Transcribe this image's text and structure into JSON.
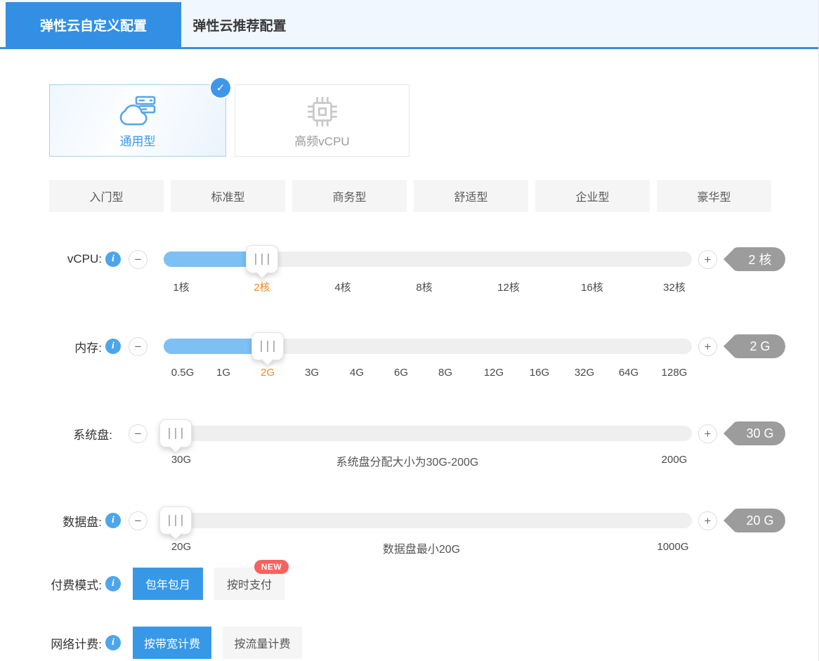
{
  "colors": {
    "accent": "#338FE3",
    "slider_fill": "#7EC0F3",
    "badge_bg": "#9C9C9C",
    "active_tick": "#F5861F",
    "new_badge_bg": "#F8625E"
  },
  "glyphs": {
    "minus": "−",
    "plus": "+",
    "info": "i",
    "check": "✓"
  },
  "tabs": [
    {
      "label": "弹性云自定义配置",
      "active": true
    },
    {
      "label": "弹性云推荐配置",
      "active": false
    }
  ],
  "instance_types": [
    {
      "label": "通用型",
      "icon": "cloud-server-icon",
      "selected": true
    },
    {
      "label": "高频vCPU",
      "icon": "cpu-chip-icon",
      "selected": false
    }
  ],
  "presets": [
    "入门型",
    "标准型",
    "商务型",
    "舒适型",
    "企业型",
    "豪华型"
  ],
  "sliders": [
    {
      "label": "vCPU:",
      "has_info": true,
      "value": "2 核",
      "selected_tick": "2核",
      "ticks": [
        "1核",
        "2核",
        "4核",
        "8核",
        "12核",
        "16核",
        "32核"
      ]
    },
    {
      "label": "内存:",
      "has_info": true,
      "value": "2 G",
      "selected_tick": "2G",
      "ticks": [
        "0.5G",
        "1G",
        "2G",
        "3G",
        "4G",
        "6G",
        "8G",
        "12G",
        "16G",
        "32G",
        "64G",
        "128G"
      ]
    },
    {
      "label": "系统盘:",
      "has_info": false,
      "value": "30 G",
      "min_label": "30G",
      "hint": "系统盘分配大小为30G-200G",
      "max_label": "200G"
    },
    {
      "label": "数据盘:",
      "has_info": true,
      "value": "20 G",
      "min_label": "20G",
      "hint": "数据盘最小20G",
      "max_label": "1000G"
    }
  ],
  "payment": {
    "label": "付费模式:",
    "options": [
      {
        "label": "包年包月",
        "selected": true
      },
      {
        "label": "按时支付",
        "selected": false,
        "badge": "NEW"
      }
    ]
  },
  "network": {
    "label": "网络计费:",
    "options": [
      {
        "label": "按带宽计费",
        "selected": true
      },
      {
        "label": "按流量计费",
        "selected": false
      }
    ]
  }
}
